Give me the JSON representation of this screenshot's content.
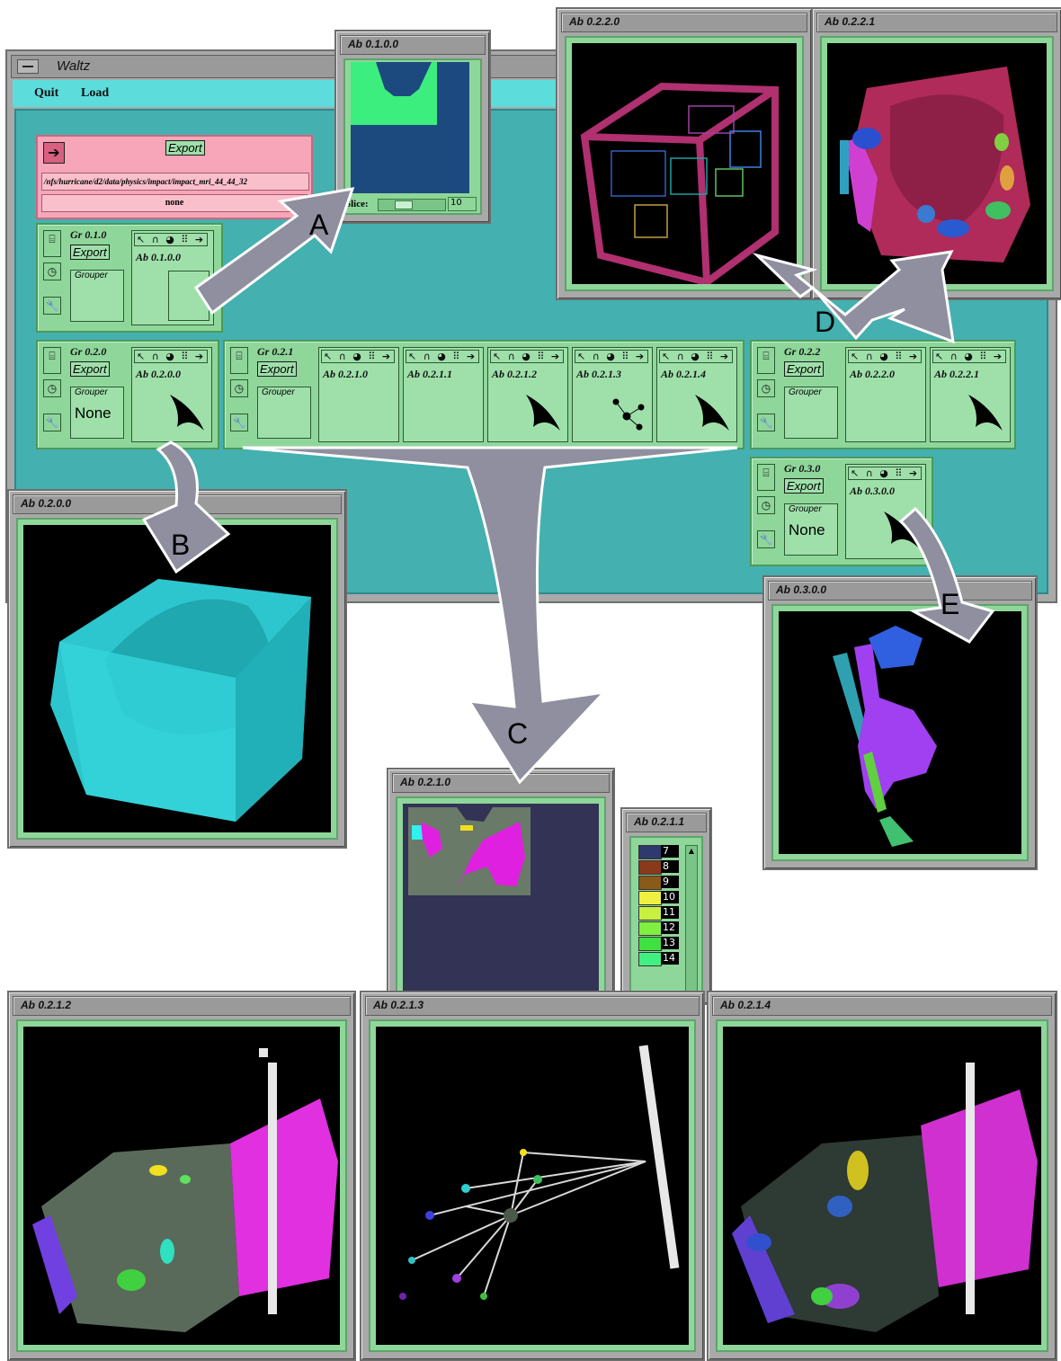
{
  "waltz": {
    "title": "Waltz",
    "menu": [
      "Quit",
      "Load"
    ]
  },
  "import_module": {
    "export_label": "Export",
    "path": "/nfs/hurricane/d2/data/physics/impact/impact_mri_44_44_32",
    "status": "none"
  },
  "groups": [
    {
      "id": "Gr 0.1.0",
      "export": "Export",
      "grouper": "Grouper",
      "grouper_value": "",
      "abstractors": [
        "Ab 0.1.0.0"
      ]
    },
    {
      "id": "Gr 0.2.0",
      "export": "Export",
      "grouper": "Grouper",
      "grouper_value": "None",
      "abstractors": [
        "Ab 0.2.0.0"
      ]
    },
    {
      "id": "Gr 0.2.1",
      "export": "Export",
      "grouper": "Grouper",
      "grouper_value": "",
      "abstractors": [
        "Ab 0.2.1.0",
        "Ab 0.2.1.1",
        "Ab 0.2.1.2",
        "Ab 0.2.1.3",
        "Ab 0.2.1.4"
      ]
    },
    {
      "id": "Gr 0.2.2",
      "export": "Export",
      "grouper": "Grouper",
      "grouper_value": "",
      "abstractors": [
        "Ab 0.2.2.0",
        "Ab 0.2.2.1"
      ]
    },
    {
      "id": "Gr 0.3.0",
      "export": "Export",
      "grouper": "Grouper",
      "grouper_value": "None",
      "abstractors": [
        "Ab 0.3.0.0"
      ]
    }
  ],
  "toolbar_icons": "↖ ∩ ◕ ⠿ ➔",
  "windows": {
    "w0100": {
      "title": "Ab 0.1.0.0",
      "slice_label": "Slice:",
      "slice_value": "10"
    },
    "w0220": {
      "title": "Ab 0.2.2.0"
    },
    "w0221": {
      "title": "Ab 0.2.2.1"
    },
    "w0200": {
      "title": "Ab 0.2.0.0"
    },
    "w0300": {
      "title": "Ab 0.3.0.0"
    },
    "w0210": {
      "title": "Ab 0.2.1.0"
    },
    "w0211": {
      "title": "Ab 0.2.1.1"
    },
    "w0212": {
      "title": "Ab 0.2.1.2"
    },
    "w0213": {
      "title": "Ab 0.2.1.3"
    },
    "w0214": {
      "title": "Ab 0.2.1.4"
    }
  },
  "legend": [
    {
      "num": "7",
      "color": "#2e3a6e"
    },
    {
      "num": "8",
      "color": "#8a3a1a"
    },
    {
      "num": "9",
      "color": "#8a5a1a"
    },
    {
      "num": "10",
      "color": "#f0f040"
    },
    {
      "num": "11",
      "color": "#c8f040"
    },
    {
      "num": "12",
      "color": "#80f040"
    },
    {
      "num": "13",
      "color": "#40e040"
    },
    {
      "num": "14",
      "color": "#40f080"
    }
  ],
  "arrows": [
    "A",
    "B",
    "C",
    "D",
    "E"
  ],
  "colors": {
    "workspace": "#44b0b0",
    "menubar": "#5ddcdc",
    "module": "#8fd69a",
    "import_module": "#f7a5b8",
    "arrow": "#8f8fa0"
  }
}
